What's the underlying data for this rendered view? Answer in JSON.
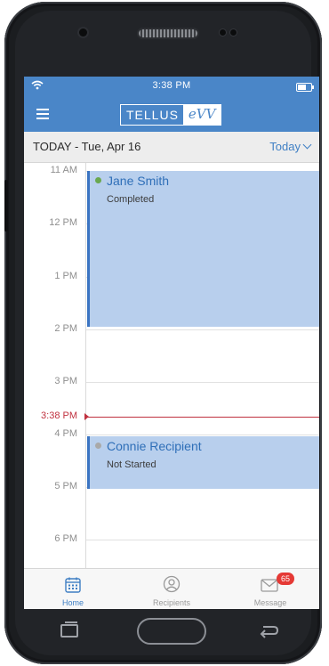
{
  "status_bar": {
    "time": "3:38 PM"
  },
  "header": {
    "logo_left": "TELLUS",
    "logo_right": "eVV"
  },
  "date_bar": {
    "title": "TODAY - Tue, Apr 16",
    "today_button": "Today"
  },
  "calendar": {
    "hours": [
      "11 AM",
      "12 PM",
      "1 PM",
      "2 PM",
      "3 PM",
      "4 PM",
      "5 PM",
      "6 PM"
    ],
    "current_time_label": "3:38 PM",
    "events": [
      {
        "name": "Jane Smith",
        "status": "Completed",
        "status_color": "#6aa84f"
      },
      {
        "name": "Connie Recipient",
        "status": "Not Started",
        "status_color": "#a9a9a9"
      }
    ]
  },
  "tab_bar": {
    "home_label": "Home",
    "recipients_label": "Recipients",
    "message_label": "Message",
    "message_badge": "65"
  },
  "colors": {
    "accent": "#4a86c8",
    "event_fill": "#b8cfed",
    "now_line": "#c0313f",
    "badge": "#e53935"
  },
  "icons": [
    "wifi-icon",
    "battery-icon",
    "menu-icon",
    "chevron-down-icon",
    "calendar-icon",
    "person-icon",
    "envelope-icon"
  ]
}
